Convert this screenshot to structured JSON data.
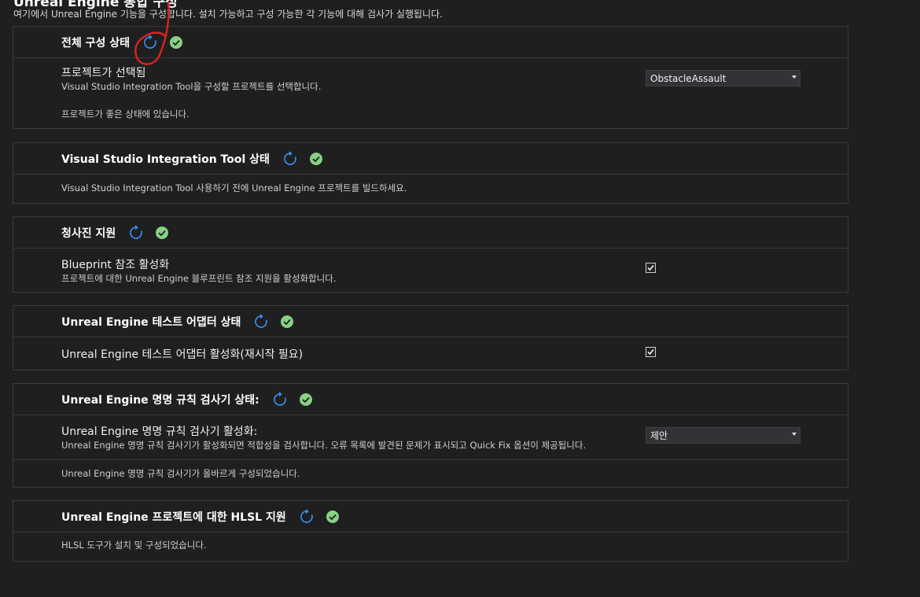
{
  "header": {
    "title": "Unreal Engine 통합 구성",
    "description": "여기에서 Unreal Engine 기능을 구성합니다. 설치 가능하고 구성 가능한 각 기능에 대해 검사가 실행됩니다."
  },
  "sections": [
    {
      "title": "전체 구성 상태",
      "project_label": "프로젝트가 선택됨",
      "project_desc": "Visual Studio Integration Tool을 구성할 프로젝트를 선택합니다.",
      "project_value": "ObstacleAssault",
      "status_text": "프로젝트가 좋은 상태에 있습니다."
    },
    {
      "title": "Visual Studio Integration Tool 상태",
      "status_text": "Visual Studio Integration Tool 사용하기 전에 Unreal Engine 프로젝트를 빌드하세요."
    },
    {
      "title": "청사진 지원",
      "option_label": "Blueprint 참조 활성화",
      "option_desc": "프로젝트에 대한 Unreal Engine 블루프린트 참조 지원을 활성화합니다.",
      "checked": true
    },
    {
      "title": "Unreal Engine 테스트 어댑터 상태",
      "option_label": "Unreal Engine 테스트 어댑터 활성화(재시작 필요)",
      "checked": true
    },
    {
      "title": "Unreal Engine 명명 규칙 검사기 상태:",
      "option_label": "Unreal Engine 명명 규칙 검사기 활성화:",
      "option_desc": "Unreal Engine 명명 규칙 검사기가 활성화되면 적합성을 검사합니다. 오류 목록에 발견된 문제가 표시되고 Quick Fix 옵션이 제공됩니다.",
      "option_value": "제안",
      "status_text": "Unreal Engine 명명 규칙 검사기가 올바르게 구성되었습니다."
    },
    {
      "title": "Unreal Engine 프로젝트에 대한 HLSL 지원",
      "status_text": "HLSL 도구가 설치 및 구성되었습니다."
    }
  ],
  "icons": {
    "refresh": "refresh-icon",
    "status_ok": "check-circle-icon",
    "annotation": "red-circle-annotation"
  },
  "colors": {
    "accent_blue": "#3794ff",
    "ok_green": "#89d185",
    "annotation_red": "#e02020"
  }
}
